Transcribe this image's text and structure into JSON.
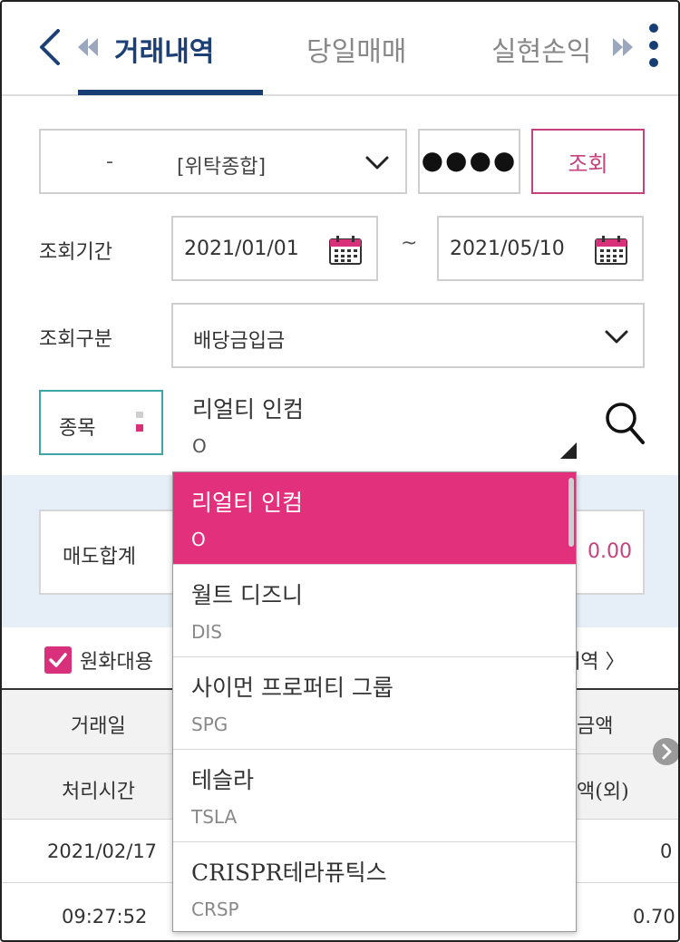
{
  "header": {
    "tabs": [
      {
        "label": "거래내역",
        "active": true
      },
      {
        "label": "당일매매",
        "active": false
      },
      {
        "label": "실현손익",
        "active": false
      }
    ]
  },
  "account": {
    "dash": "-",
    "name": "[위탁종합]",
    "password_mask": "●●●●",
    "query_label": "조회"
  },
  "period": {
    "label": "조회기간",
    "from": "2021/01/01",
    "separator": "~",
    "to": "2021/05/10"
  },
  "category": {
    "label": "조회구분",
    "value": "배당금입금"
  },
  "stock": {
    "label": "종목",
    "name": "리얼티 인컴",
    "ticker": "O"
  },
  "summary": {
    "label": "매도합계",
    "value": "0.00"
  },
  "options": {
    "currency_label": "원화대용",
    "currency_checked": true,
    "detail_link": "내역 〉"
  },
  "table": {
    "headers_row1": [
      "거래일",
      "금액"
    ],
    "headers_row2": [
      "처리시간",
      "액(외)"
    ],
    "rows": [
      {
        "left": "2021/02/17",
        "right": "0"
      },
      {
        "left": "09:27:52",
        "right": "0.70"
      }
    ]
  },
  "dropdown": {
    "items": [
      {
        "name": "리얼티 인컴",
        "ticker": "O",
        "selected": true
      },
      {
        "name": "월트 디즈니",
        "ticker": "DIS",
        "selected": false
      },
      {
        "name": "사이먼 프로퍼티 그룹",
        "ticker": "SPG",
        "selected": false
      },
      {
        "name": "테슬라",
        "ticker": "TSLA",
        "selected": false
      },
      {
        "name": "CRISPR테라퓨틱스",
        "ticker": "CRSP",
        "selected": false
      }
    ]
  },
  "colors": {
    "brand_navy": "#163e73",
    "accent_pink": "#e2307d",
    "summary_band": "#e6eef7",
    "stock_border": "#3aa6a8"
  },
  "icons": [
    "back-icon",
    "prev-tab-icon",
    "next-tab-icon",
    "more-icon",
    "chevron-down-icon",
    "calendar-icon",
    "search-icon",
    "check-icon",
    "scroll-right-icon"
  ]
}
